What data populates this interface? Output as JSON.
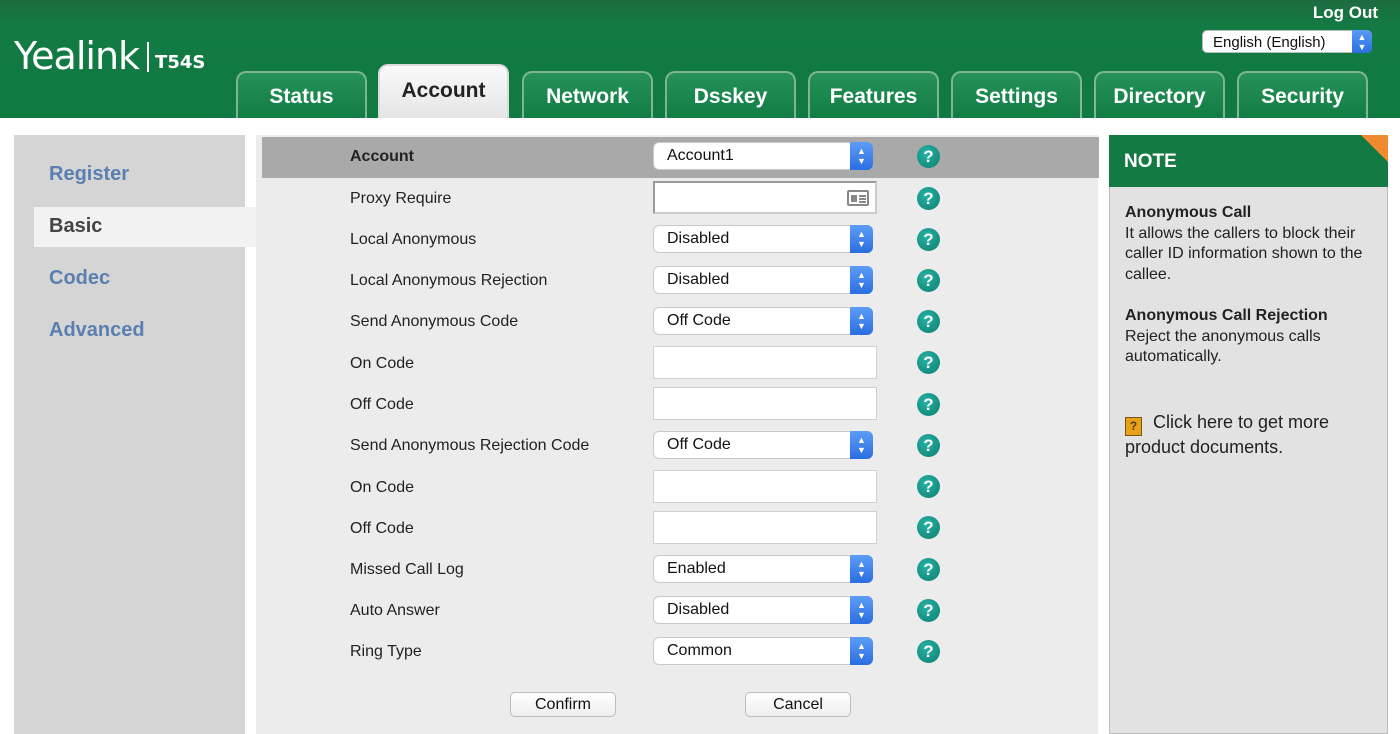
{
  "header": {
    "logo_brand": "Yealink",
    "logo_model": "T54S",
    "logout_label": "Log Out",
    "language": "English (English)"
  },
  "tabs": [
    {
      "label": "Status"
    },
    {
      "label": "Account"
    },
    {
      "label": "Network"
    },
    {
      "label": "Dsskey"
    },
    {
      "label": "Features"
    },
    {
      "label": "Settings"
    },
    {
      "label": "Directory"
    },
    {
      "label": "Security"
    }
  ],
  "active_tab": "Account",
  "sidebar": {
    "items": [
      {
        "label": "Register"
      },
      {
        "label": "Basic"
      },
      {
        "label": "Codec"
      },
      {
        "label": "Advanced"
      }
    ],
    "active": "Basic"
  },
  "form": {
    "account": {
      "label": "Account",
      "value": "Account1"
    },
    "proxy_require": {
      "label": "Proxy Require",
      "value": ""
    },
    "local_anonymous": {
      "label": "Local Anonymous",
      "value": "Disabled"
    },
    "local_anonymous_rejection": {
      "label": "Local Anonymous Rejection",
      "value": "Disabled"
    },
    "send_anonymous_code": {
      "label": "Send Anonymous Code",
      "value": "Off Code"
    },
    "anon_on_code": {
      "label": "On Code",
      "value": ""
    },
    "anon_off_code": {
      "label": "Off Code",
      "value": ""
    },
    "send_anonymous_rejection_code": {
      "label": "Send Anonymous Rejection Code",
      "value": "Off Code"
    },
    "rej_on_code": {
      "label": "On Code",
      "value": ""
    },
    "rej_off_code": {
      "label": "Off Code",
      "value": ""
    },
    "missed_call_log": {
      "label": "Missed Call Log",
      "value": "Enabled"
    },
    "auto_answer": {
      "label": "Auto Answer",
      "value": "Disabled"
    },
    "ring_type": {
      "label": "Ring Type",
      "value": "Common"
    },
    "help_symbol": "?",
    "confirm_label": "Confirm",
    "cancel_label": "Cancel"
  },
  "note": {
    "title": "NOTE",
    "sections": [
      {
        "heading": "Anonymous Call",
        "text": "It allows the callers to block their caller ID information shown to the callee."
      },
      {
        "heading": "Anonymous Call Rejection",
        "text": "Reject the anonymous calls automatically."
      }
    ],
    "link_text": "Click here to get more product documents."
  },
  "colors": {
    "header_green": "#137a43",
    "sidebar_link": "#5b7fb0",
    "help_teal": "#139c8c",
    "note_corner": "#f08a30"
  }
}
